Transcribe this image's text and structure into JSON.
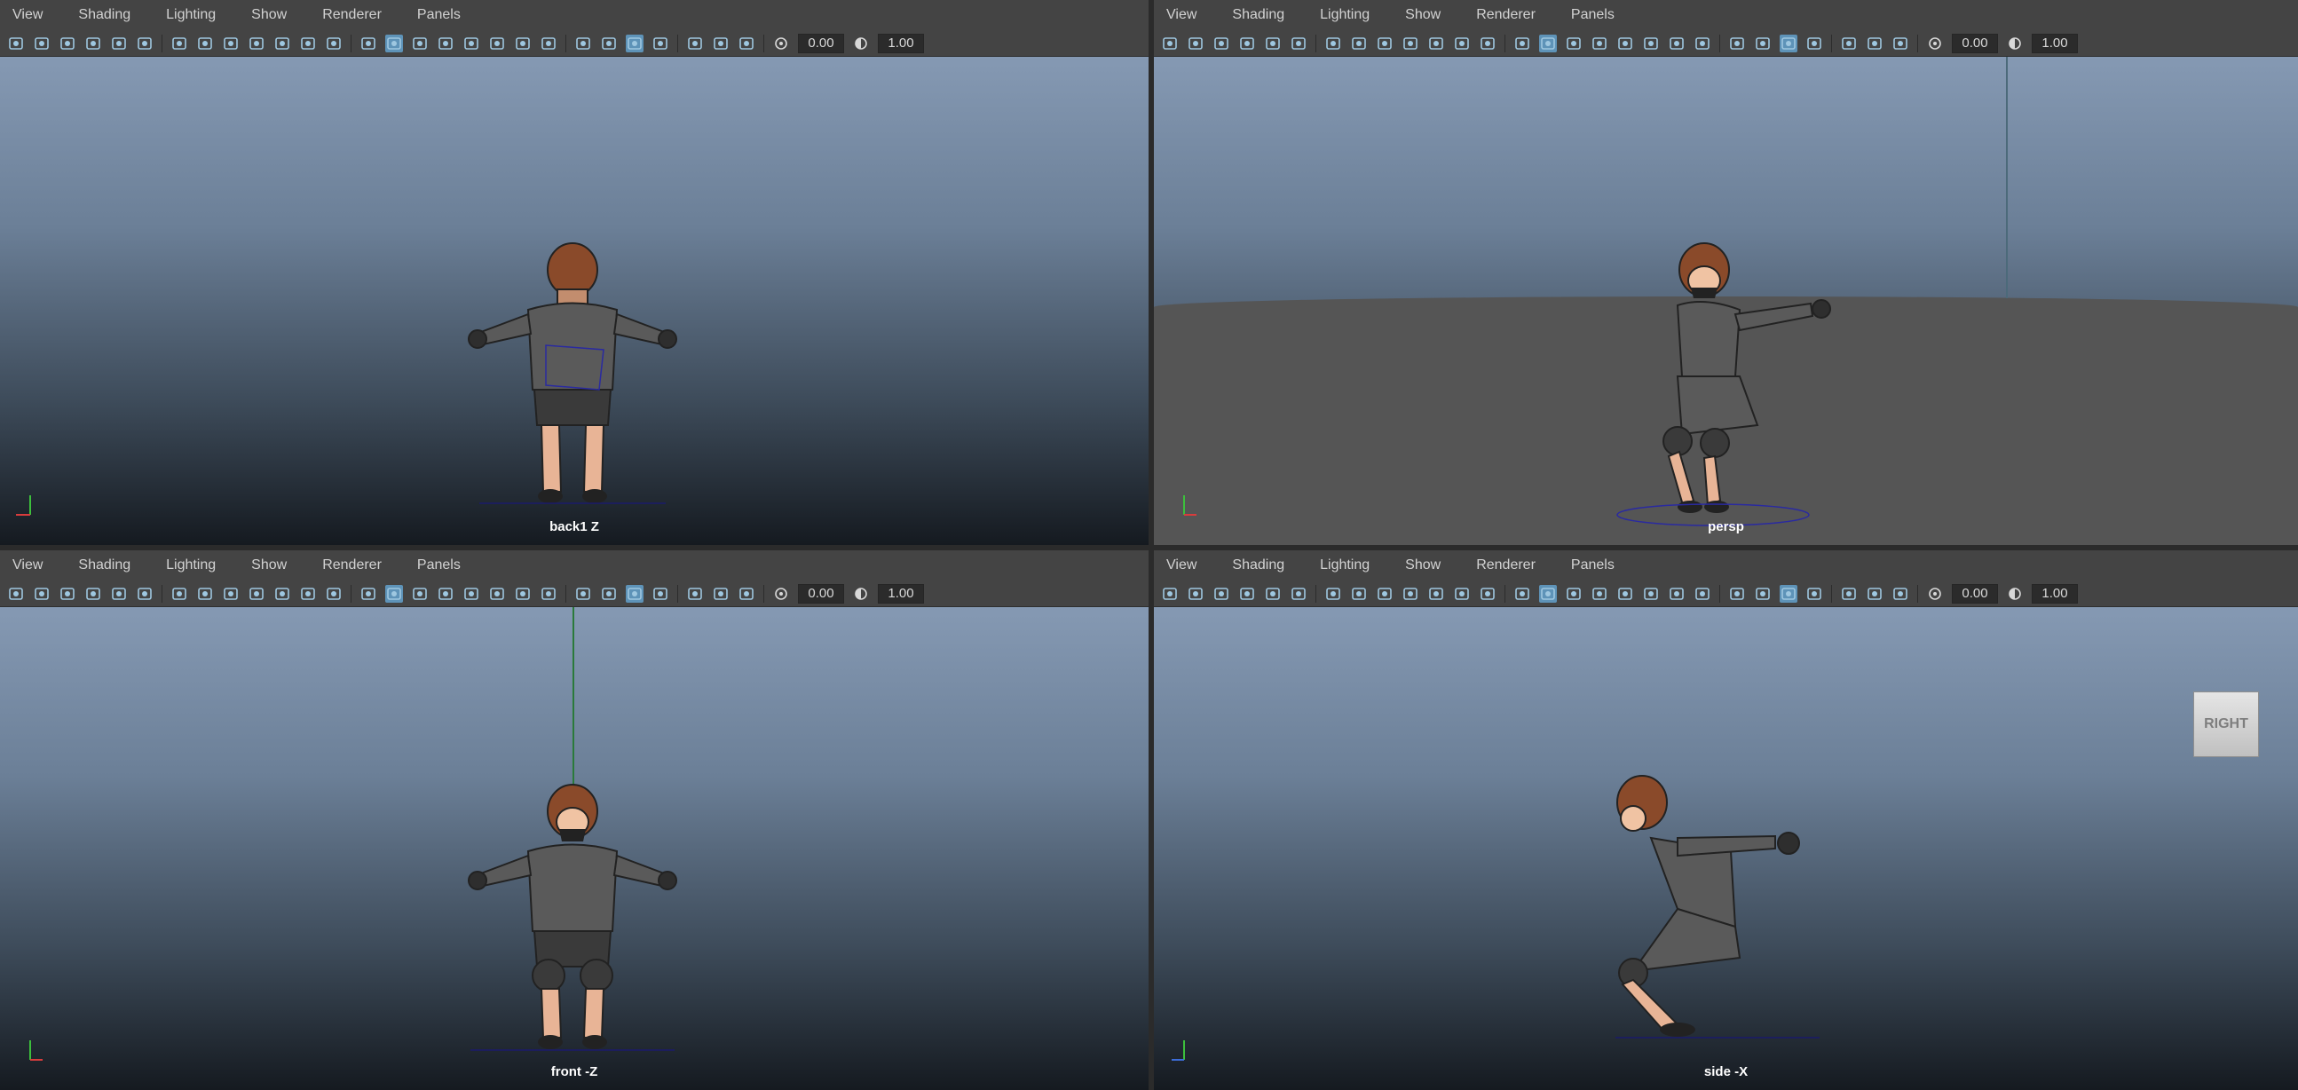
{
  "colors": {
    "menubar_bg": "#444444",
    "menu_text": "#d2d2d2",
    "active_icon_bg": "#5e93b8",
    "viewport_top": "#8599b3",
    "viewport_bottom": "#151a20",
    "label": "#ffffff"
  },
  "menu_items": [
    "View",
    "Shading",
    "Lighting",
    "Show",
    "Renderer",
    "Panels"
  ],
  "toolbar": {
    "icons": [
      "select-camera-icon",
      "camera-attributes-icon",
      "bookmark-icon",
      "image-plane-icon",
      "two-d-pan-zoom-icon",
      "grease-pencil-icon",
      "grid-icon",
      "film-gate-icon",
      "resolution-gate-icon",
      "gate-mask-icon",
      "field-chart-icon",
      "safe-action-icon",
      "safe-title-icon",
      "wireframe-icon",
      "smooth-shade-icon",
      "use-default-material-icon",
      "wireframe-on-shaded-icon",
      "xray-icon",
      "textured-icon",
      "lighting-icon",
      "shadows-icon",
      "screen-space-ao-icon",
      "motion-blur-icon",
      "multisample-aa-icon",
      "depth-of-field-icon",
      "isolate-select-icon",
      "xray-joints-icon",
      "xray-active-icon",
      "exposure-icon",
      "gamma-icon"
    ],
    "exposure_value": "0.00",
    "gamma_value": "1.00"
  },
  "panels": [
    {
      "camera_label": "back1 Z",
      "axis": {
        "up": "y",
        "side": "x"
      },
      "view": "back"
    },
    {
      "camera_label": "persp",
      "axis": {
        "up": "y",
        "side": "x"
      },
      "view": "persp"
    },
    {
      "camera_label": "front -Z",
      "axis": {
        "up": "y",
        "side": "x"
      },
      "view": "front"
    },
    {
      "camera_label": "side -X",
      "axis": {
        "up": "y",
        "side": "z"
      },
      "view": "side",
      "view_cube_label": "RIGHT"
    }
  ]
}
